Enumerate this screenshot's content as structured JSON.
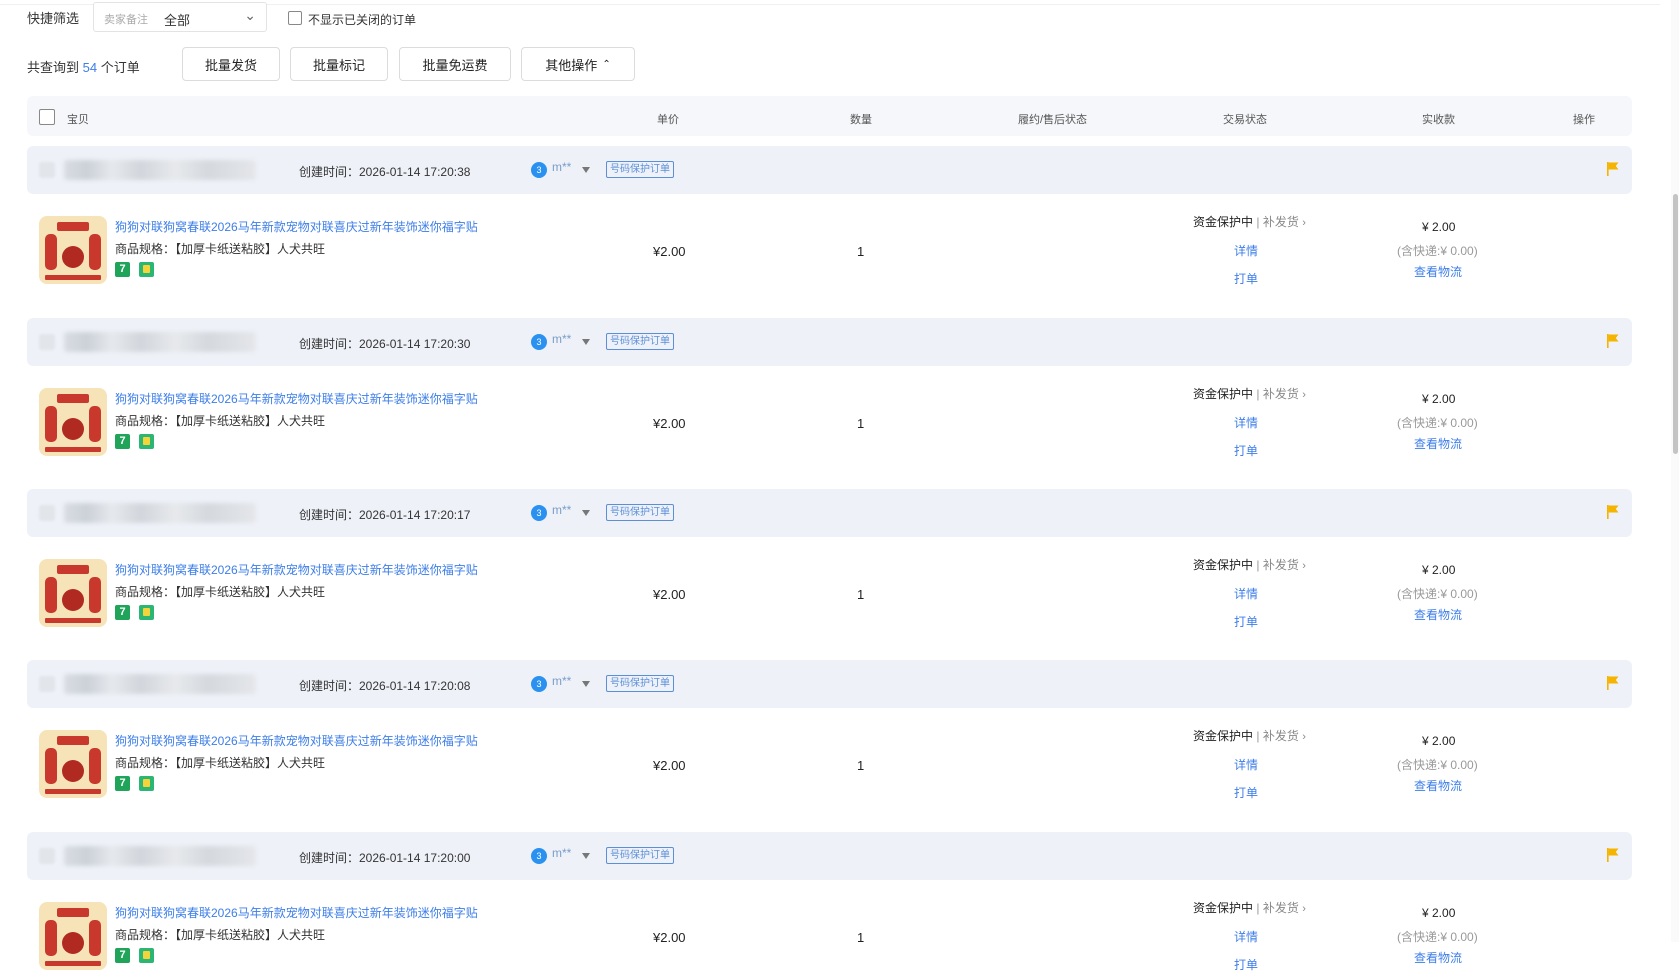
{
  "filter": {
    "label": "快捷筛选",
    "remark_placeholder": "卖家备注",
    "remark_value": "全部",
    "hide_closed_label": "不显示已关闭的订单"
  },
  "summary": {
    "prefix": "共查询到",
    "count": "54",
    "suffix": "个订单"
  },
  "actions": {
    "batch_ship": "批量发货",
    "batch_mark": "批量标记",
    "batch_free_shipping": "批量免运费",
    "more_ops": "其他操作"
  },
  "table_header": {
    "item": "宝贝",
    "unit_price": "单价",
    "quantity": "数量",
    "fulfillment_status": "履约/售后状态",
    "trade_status": "交易状态",
    "received": "实收款",
    "operation": "操作"
  },
  "common": {
    "product_title": "狗狗对联狗窝春联2026马年新款宠物对联喜庆过新年装饰迷你福字贴",
    "product_spec": "商品规格：【加厚卡纸送粘胶】人犬共旺",
    "price": "¥2.00",
    "quantity": "1",
    "status_main": "资金保护中",
    "status_sep": "|",
    "status_sub": "补发货",
    "details_link": "详情",
    "print_link": "打单",
    "received": "¥ 2.00",
    "shipping_fee": "(含快递:¥ 0.00)",
    "logistics_link": "查看物流",
    "buyer": "m**",
    "protect_tag": "号码保护订单",
    "bubble_glyph": "3"
  },
  "orders": [
    {
      "created": "创建时间：2026-01-14 17:20:38"
    },
    {
      "created": "创建时间：2026-01-14 17:20:30"
    },
    {
      "created": "创建时间：2026-01-14 17:20:17"
    },
    {
      "created": "创建时间：2026-01-14 17:20:08"
    },
    {
      "created": "创建时间：2026-01-14 17:20:00"
    }
  ],
  "colors": {
    "link": "#3d7ee8",
    "flag": "#f5b400",
    "order_header_bg": "#eef2f8",
    "header_bg": "#f5f7fa"
  }
}
